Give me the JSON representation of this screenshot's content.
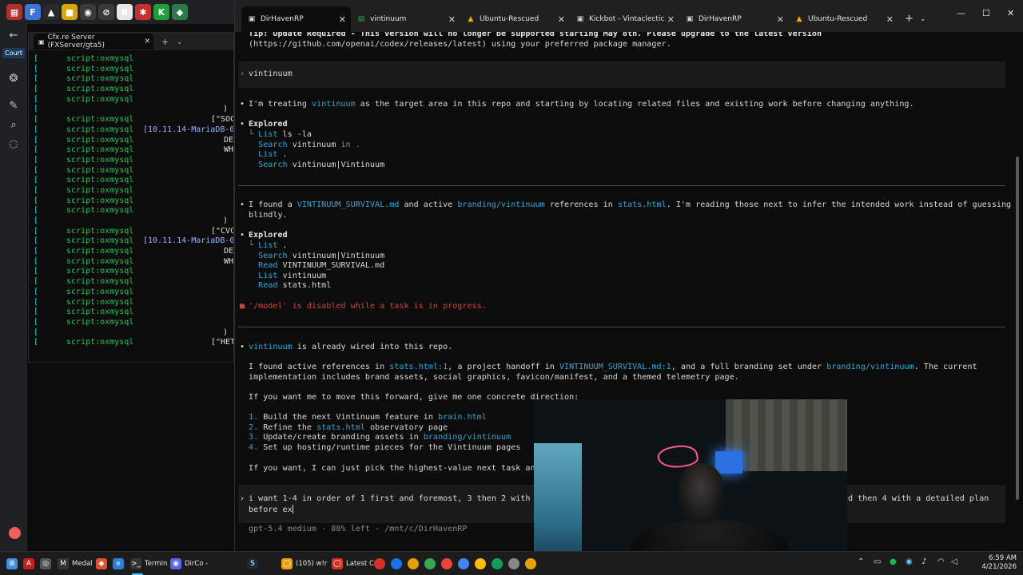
{
  "browser": {
    "court_label": "Court",
    "tab_icons": [
      {
        "name": "app-icon-1",
        "color": "#b0302a",
        "glyph": "▦"
      },
      {
        "name": "app-icon-2",
        "color": "#3d73d6",
        "glyph": "F"
      },
      {
        "name": "google-drive-icon",
        "color": "#2a2a2a",
        "glyph": "▲"
      },
      {
        "name": "app-icon-4",
        "color": "#d8a600",
        "glyph": "■"
      },
      {
        "name": "app-icon-5",
        "color": "#3a3a3a",
        "glyph": "◉"
      },
      {
        "name": "app-icon-6",
        "color": "#3a3a3a",
        "glyph": "⊘"
      },
      {
        "name": "app-icon-7",
        "color": "#e8e8e8",
        "glyph": "B"
      },
      {
        "name": "app-icon-8",
        "color": "#c23030",
        "glyph": "✱"
      },
      {
        "name": "app-icon-9",
        "color": "#1f9e3c",
        "glyph": "K"
      },
      {
        "name": "app-icon-10",
        "color": "#2a7a4a",
        "glyph": "◆"
      }
    ]
  },
  "fx": {
    "tab_title": "Cfx.re Server (FXServer/gta5)",
    "lines": [
      {
        "src": "script:oxmysql",
        "right": ""
      },
      {
        "src": "script:oxmysql",
        "right": ""
      },
      {
        "src": "script:oxmysql",
        "right": ""
      },
      {
        "src": "script:oxmysql",
        "right": ""
      },
      {
        "src": "script:oxmysql",
        "right": ""
      },
      {
        "src": "",
        "right": ")"
      },
      {
        "src": "script:oxmysql",
        "right": "[\"SOC\""
      },
      {
        "src": "script:oxmysql",
        "right": "[10.11.14-MariaDB-0"
      },
      {
        "src": "script:oxmysql",
        "right": "DEL"
      },
      {
        "src": "script:oxmysql",
        "right": "WHE"
      },
      {
        "src": "script:oxmysql",
        "right": ""
      },
      {
        "src": "script:oxmysql",
        "right": ""
      },
      {
        "src": "script:oxmysql",
        "right": ""
      },
      {
        "src": "script:oxmysql",
        "right": ""
      },
      {
        "src": "script:oxmysql",
        "right": ""
      },
      {
        "src": "script:oxmysql",
        "right": ""
      },
      {
        "src": "",
        "right": ")"
      },
      {
        "src": "script:oxmysql",
        "right": "[\"CVC\""
      },
      {
        "src": "script:oxmysql",
        "right": "[10.11.14-MariaDB-0"
      },
      {
        "src": "script:oxmysql",
        "right": "DEL"
      },
      {
        "src": "script:oxmysql",
        "right": "WHE"
      },
      {
        "src": "script:oxmysql",
        "right": ""
      },
      {
        "src": "script:oxmysql",
        "right": ""
      },
      {
        "src": "script:oxmysql",
        "right": ""
      },
      {
        "src": "script:oxmysql",
        "right": ""
      },
      {
        "src": "script:oxmysql",
        "right": ""
      },
      {
        "src": "script:oxmysql",
        "right": ""
      },
      {
        "src": "",
        "right": ")"
      },
      {
        "src": "script:oxmysql",
        "right": "[\"HET\""
      }
    ]
  },
  "terminal": {
    "tabs": [
      {
        "title": "DirHavenRP",
        "icon": "terminal-icon",
        "active": true
      },
      {
        "title": "vintinuum",
        "icon": "sheet-icon",
        "active": false
      },
      {
        "title": "Ubuntu-Rescued",
        "icon": "ubuntu-icon",
        "active": false
      },
      {
        "title": "Kickbot - Vintaclectic",
        "icon": "terminal-icon",
        "active": false
      },
      {
        "title": "DirHavenRP",
        "icon": "terminal-icon",
        "active": false
      },
      {
        "title": "Ubuntu-Rescued",
        "icon": "ubuntu-icon",
        "active": false
      }
    ],
    "tip_line1": "Tip: Update Required - This version will no longer be supported starting May 8th. Please upgrade to the latest version",
    "tip_line2": "(https://github.com/openai/codex/releases/latest) using your preferred package manager.",
    "prompt1": "vintinuum",
    "msg1": {
      "pre": "I'm treating ",
      "hl": "vintinuum",
      "post": " as the target area in this repo and starting by locating related files and existing work before changing anything."
    },
    "explored_label": "Explored",
    "explored1": [
      {
        "verb": "List",
        "arg": "ls -la",
        "extra": ""
      },
      {
        "verb": "Search",
        "arg": "vintinuum",
        "extra": " in ."
      },
      {
        "verb": "List",
        "arg": ".",
        "extra": ""
      },
      {
        "verb": "Search",
        "arg": "vintinuum|Vintinuum",
        "extra": ""
      }
    ],
    "msg2": {
      "a": "I found a ",
      "b": "VINTINUUM_SURVIVAL.md",
      "c": " and active ",
      "d": "branding/vintinuum",
      "e": " references in ",
      "f": "stats.html",
      "g": ". I'm reading those next to infer the intended work instead of guessing",
      "line2": "blindly."
    },
    "explored2": [
      {
        "verb": "List",
        "arg": ".",
        "extra": ""
      },
      {
        "verb": "Search",
        "arg": "vintinuum|Vintinuum",
        "extra": ""
      },
      {
        "verb": "Read",
        "arg": "VINTINUUM_SURVIVAL.md",
        "extra": ""
      },
      {
        "verb": "List",
        "arg": "vintinuum",
        "extra": ""
      },
      {
        "verb": "Read",
        "arg": "stats.html",
        "extra": ""
      }
    ],
    "error": "'/model' is disabled while a task is in progress.",
    "msg3": {
      "hl": "vintinuum",
      "post": " is already wired into this repo."
    },
    "msg4": {
      "a": "I found active references in ",
      "b": "stats.html:1",
      "c": ", a project handoff in ",
      "d": "VINTINUUM_SURVIVAL.md:1",
      "e": ", and a full branding set under ",
      "f": "branding/vintinuum",
      "g": ". The current",
      "line2": "implementation includes brand assets, social graphics, favicon/manifest, and a themed telemetry page."
    },
    "msg5": "If you want me to move this forward, give me one concrete direction:",
    "options": [
      {
        "num": "1.",
        "text": "Build the next Vintinuum feature in ",
        "hl": "brain.html",
        "tail": ""
      },
      {
        "num": "2.",
        "text": "Refine the ",
        "hl": "stats.html",
        "tail": " observatory page"
      },
      {
        "num": "3.",
        "text": "Update/create branding assets in ",
        "hl": "branding/vintinuum",
        "tail": ""
      },
      {
        "num": "4.",
        "text": "Set up hosting/runtime pieces for the Vintinuum pages",
        "hl": "",
        "tail": ""
      }
    ],
    "msg6": "If you want, I can just pick the highest-value next task and",
    "input_line1_left": "i want 1-4 in order of 1 first and foremost, 3 then 2 with a",
    "input_line1_right": "d then 4 with a detailed plan",
    "input_line2": "before ex",
    "status": "gpt-5.4 medium · 88% left · /mnt/c/DirHavenRP"
  },
  "taskbar": {
    "items": [
      {
        "name": "windows-start-icon",
        "label": "",
        "color": "#3b8ee8",
        "glyph": "⊞"
      },
      {
        "name": "acrobat-icon",
        "label": "",
        "color": "#c81e1e",
        "glyph": "A"
      },
      {
        "name": "app-icon",
        "label": "",
        "color": "#555",
        "glyph": "◎"
      },
      {
        "name": "folder-icon",
        "label": "",
        "color": "#d9a520",
        "glyph": "▬"
      },
      {
        "name": "medal-icon",
        "label": "Medal",
        "color": "#333",
        "glyph": "M"
      },
      {
        "name": "brave-icon",
        "label": "",
        "color": "#e0502a",
        "glyph": "◆"
      },
      {
        "name": "edge-icon",
        "label": "",
        "color": "#2c7fd6",
        "glyph": "e"
      },
      {
        "name": "terminal-icon",
        "label": "Termin",
        "color": "#333",
        "glyph": ">_"
      },
      {
        "name": "discord-icon",
        "label": "DirCo -",
        "color": "#5865f2",
        "glyph": "◉"
      },
      {
        "name": "steam-icon",
        "label": "",
        "color": "#1b2838",
        "glyph": "S"
      },
      {
        "name": "chrome-icon",
        "label": "(105) w!r",
        "color": "#e8a000",
        "glyph": "◯"
      },
      {
        "name": "chrome-icon-2",
        "label": "Latest Cc",
        "color": "#d93025",
        "glyph": "◯"
      }
    ],
    "time": "6:59 AM",
    "date": "4/21/2026"
  }
}
